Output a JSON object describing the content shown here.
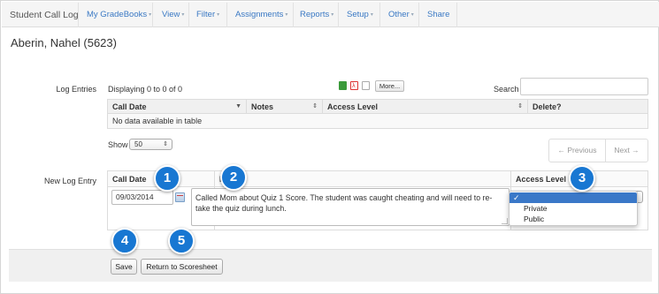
{
  "nav": {
    "brand": "Student Call Log",
    "items": [
      {
        "label": "My GradeBooks",
        "caret": "▾"
      },
      {
        "label": "View",
        "caret": "▾"
      },
      {
        "label": "Filter",
        "caret": "▾"
      },
      {
        "label": "Assignments",
        "caret": "▾"
      },
      {
        "label": "Reports",
        "caret": "▾"
      },
      {
        "label": "Setup",
        "caret": "▾"
      },
      {
        "label": "Other",
        "caret": "▾"
      },
      {
        "label": "Share",
        "caret": ""
      }
    ]
  },
  "page": {
    "title": "Aberin, Nahel (5623)"
  },
  "log_entries": {
    "label": "Log Entries",
    "displaying": "Displaying 0 to 0 of 0",
    "more_label": "More...",
    "search_label": "Search",
    "search_value": "",
    "columns": [
      "Call Date",
      "Notes",
      "Access Level",
      "Delete?"
    ],
    "empty_text": "No data available in table",
    "show_label": "Show",
    "show_value": "50",
    "prev_label": "← Previous",
    "next_label": "Next →",
    "export_icons": [
      "excel-icon",
      "pdf-icon",
      "document-icon"
    ]
  },
  "new_entry": {
    "label": "New Log Entry",
    "columns": [
      "Call Date",
      "Notes",
      "Access Level"
    ],
    "date_value": "09/03/2014",
    "notes_value": "Called Mom about Quiz 1 Score. The student was caught cheating and will need to re-take the quiz during lunch.",
    "access_options": [
      "",
      "Private",
      "Public"
    ],
    "access_check": "✓"
  },
  "actions": {
    "save_label": "Save",
    "return_label": "Return to Scoresheet"
  },
  "callouts": [
    "1",
    "2",
    "3",
    "4",
    "5"
  ],
  "colors": {
    "accent": "#1877d2",
    "link": "#3a79c4",
    "dropdown_selected": "#3a78c8"
  }
}
